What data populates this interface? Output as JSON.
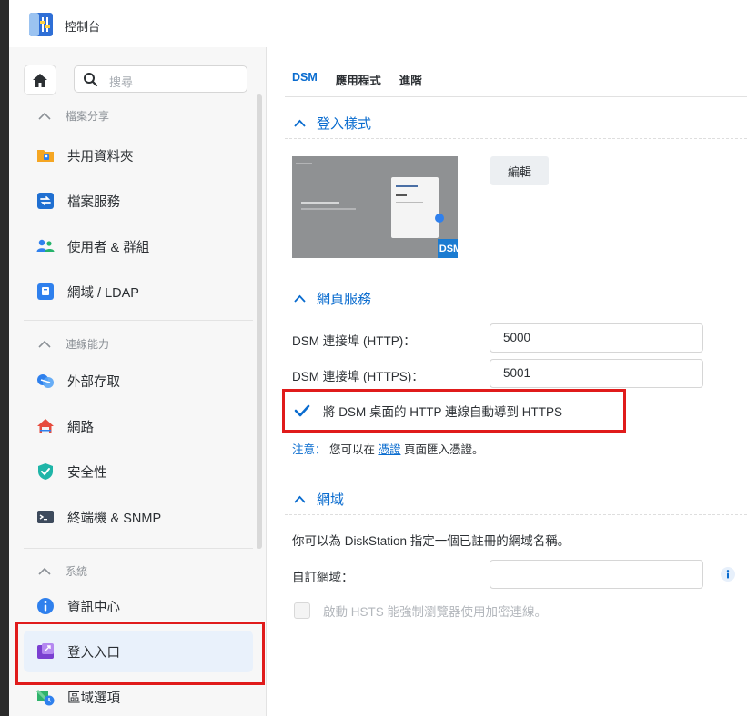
{
  "window": {
    "title": "控制台"
  },
  "sidebar": {
    "search_placeholder": "搜尋",
    "sections": [
      {
        "label": "檔案分享"
      },
      {
        "label": "連線能力"
      },
      {
        "label": "系統"
      }
    ],
    "items": [
      {
        "label": "共用資料夾",
        "icon": "shared-folder-icon"
      },
      {
        "label": "檔案服務",
        "icon": "file-services-icon"
      },
      {
        "label": "使用者 & 群組",
        "icon": "users-groups-icon"
      },
      {
        "label": "網域 / LDAP",
        "icon": "domain-ldap-icon"
      },
      {
        "label": "外部存取",
        "icon": "external-access-icon"
      },
      {
        "label": "網路",
        "icon": "network-icon"
      },
      {
        "label": "安全性",
        "icon": "security-shield-icon"
      },
      {
        "label": "終端機 & SNMP",
        "icon": "terminal-icon"
      },
      {
        "label": "資訊中心",
        "icon": "info-center-icon"
      },
      {
        "label": "登入入口",
        "icon": "login-portal-icon",
        "active": true
      },
      {
        "label": "區域選項",
        "icon": "regional-options-icon"
      }
    ]
  },
  "tabs": [
    {
      "label": "DSM",
      "active": true
    },
    {
      "label": "應用程式"
    },
    {
      "label": "進階"
    }
  ],
  "login_style": {
    "title": "登入樣式",
    "edit_label": "編輯",
    "badge": "DSM"
  },
  "web_services": {
    "title": "網頁服務",
    "http_label": "DSM 連接埠 (HTTP)：",
    "http_value": "5000",
    "https_label": "DSM 連接埠 (HTTPS)：",
    "https_value": "5001",
    "redirect_label": "將 DSM 桌面的 HTTP 連線自動導到 HTTPS",
    "redirect_checked": true,
    "note_prefix": "注意：",
    "note_before": " 您可以在 ",
    "note_link": "憑證",
    "note_after": " 頁面匯入憑證。"
  },
  "domain": {
    "title": "網域",
    "description": "你可以為 DiskStation 指定一個已註冊的網域名稱。",
    "custom_label": "自訂網域：",
    "custom_value": "",
    "hsts_label": "啟動 HSTS 能強制瀏覽器使用加密連線。",
    "hsts_checked": false
  },
  "colors": {
    "accent": "#0a6ccf",
    "highlight_box": "#e01b1b",
    "active_item_bg": "#e9f1fb"
  }
}
